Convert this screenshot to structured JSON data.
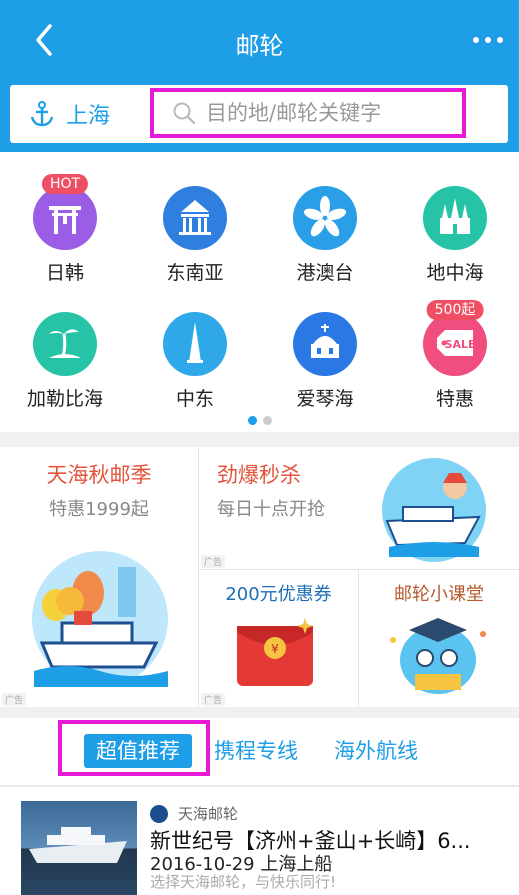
{
  "header": {
    "title": "邮轮",
    "back_icon": "chevron-left-icon",
    "more_icon": "more-dots-icon"
  },
  "search": {
    "city": "上海",
    "placeholder": "目的地/邮轮关键字"
  },
  "categories": [
    {
      "label": "日韩",
      "badge": "HOT",
      "icon": "torii-gate-icon",
      "color": "#9b5de5"
    },
    {
      "label": "东南亚",
      "badge": "",
      "icon": "temple-icon",
      "color": "#2f7fe0"
    },
    {
      "label": "港澳台",
      "badge": "",
      "icon": "bauhinia-icon",
      "color": "#2a9ee6"
    },
    {
      "label": "地中海",
      "badge": "",
      "icon": "cathedral-icon",
      "color": "#26c3a7"
    },
    {
      "label": "加勒比海",
      "badge": "",
      "icon": "palm-island-icon",
      "color": "#26c3a7"
    },
    {
      "label": "中东",
      "badge": "",
      "icon": "tower-icon",
      "color": "#2fa8ea"
    },
    {
      "label": "爱琴海",
      "badge": "",
      "icon": "dome-church-icon",
      "color": "#2a78e4"
    },
    {
      "label": "特惠",
      "badge": "500起",
      "icon": "sale-tag-icon",
      "color": "#f04e7e"
    }
  ],
  "pager": {
    "active_color": "#1d9ee6",
    "inactive_color": "#cccccc"
  },
  "promo": {
    "main": {
      "title": "天海秋邮季",
      "subtitle": "特惠1999起"
    },
    "flash": {
      "title": "劲爆秒杀",
      "subtitle": "每日十点开抢"
    },
    "coupon": {
      "title": "200元优惠券"
    },
    "lesson": {
      "title": "邮轮小课堂"
    },
    "ad_label": "广告"
  },
  "tabs": {
    "active": "超值推荐",
    "items": [
      "携程专线",
      "海外航线"
    ]
  },
  "listing": {
    "brand": "天海邮轮",
    "name": "新世纪号【济州+釜山+长崎】6...",
    "date": "2016-10-29 上海上船",
    "slogan": "选择天海邮轮，与快乐同行!"
  },
  "colors": {
    "brand_blue": "#1d9ee6",
    "highlight": "#e619d6",
    "promo_red": "#e5533c",
    "promo_brown": "#b65b2d"
  }
}
